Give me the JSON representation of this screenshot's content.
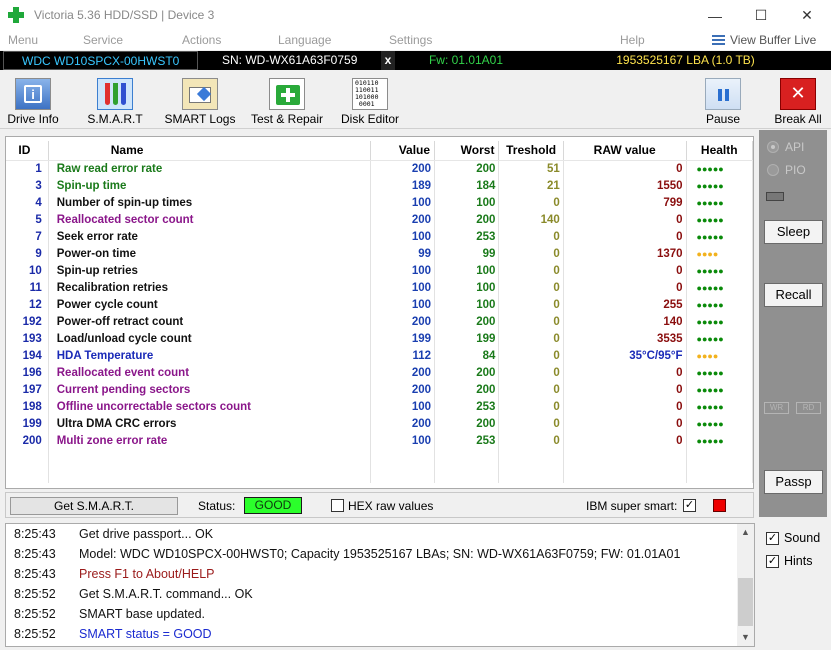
{
  "window": {
    "title": "Victoria 5.36 HDD/SSD | Device 3",
    "minimize": "—",
    "maximize": "☐",
    "close": "✕"
  },
  "menu": {
    "items": [
      "Menu",
      "Service",
      "Actions",
      "Language",
      "Settings",
      "Help"
    ],
    "view_buffer": "View Buffer Live"
  },
  "device": {
    "model": "WDC WD10SPCX-00HWST0",
    "serial": "SN: WD-WX61A63F0759",
    "x": "x",
    "firmware": "Fw: 01.01A01",
    "lba": "1953525167 LBA (1.0 TB)"
  },
  "toolbar": {
    "drive_info": "Drive Info",
    "smart": "S.M.A.R.T",
    "smart_logs": "SMART Logs",
    "test_repair": "Test & Repair",
    "disk_editor": "Disk Editor",
    "pause": "Pause",
    "break_all": "Break All",
    "binary_glyph": "010110\n110011\n101000\n0001"
  },
  "smart": {
    "headers": [
      "ID",
      "Name",
      "Value",
      "Worst",
      "Treshold",
      "RAW value",
      "Health"
    ],
    "rows": [
      {
        "id": "1",
        "name": "Raw read error rate",
        "value": "200",
        "worst": "200",
        "tresh": "51",
        "raw": "0",
        "health": "●●●●●",
        "hcolor": "green",
        "ncolor": "#1a7a1a"
      },
      {
        "id": "3",
        "name": "Spin-up time",
        "value": "189",
        "worst": "184",
        "tresh": "21",
        "raw": "1550",
        "health": "●●●●●",
        "hcolor": "green",
        "ncolor": "#1a7a1a"
      },
      {
        "id": "4",
        "name": "Number of spin-up times",
        "value": "100",
        "worst": "100",
        "tresh": "0",
        "raw": "799",
        "health": "●●●●●",
        "hcolor": "green",
        "ncolor": "#111111"
      },
      {
        "id": "5",
        "name": "Reallocated sector count",
        "value": "200",
        "worst": "200",
        "tresh": "140",
        "raw": "0",
        "health": "●●●●●",
        "hcolor": "green",
        "ncolor": "#8a168a"
      },
      {
        "id": "7",
        "name": "Seek error rate",
        "value": "100",
        "worst": "253",
        "tresh": "0",
        "raw": "0",
        "health": "●●●●●",
        "hcolor": "green",
        "ncolor": "#111111"
      },
      {
        "id": "9",
        "name": "Power-on time",
        "value": "99",
        "worst": "99",
        "tresh": "0",
        "raw": "1370",
        "health": "●●●●",
        "hcolor": "yellow",
        "ncolor": "#111111"
      },
      {
        "id": "10",
        "name": "Spin-up retries",
        "value": "100",
        "worst": "100",
        "tresh": "0",
        "raw": "0",
        "health": "●●●●●",
        "hcolor": "green",
        "ncolor": "#111111"
      },
      {
        "id": "11",
        "name": "Recalibration retries",
        "value": "100",
        "worst": "100",
        "tresh": "0",
        "raw": "0",
        "health": "●●●●●",
        "hcolor": "green",
        "ncolor": "#111111"
      },
      {
        "id": "12",
        "name": "Power cycle count",
        "value": "100",
        "worst": "100",
        "tresh": "0",
        "raw": "255",
        "health": "●●●●●",
        "hcolor": "green",
        "ncolor": "#111111"
      },
      {
        "id": "192",
        "name": "Power-off retract count",
        "value": "200",
        "worst": "200",
        "tresh": "0",
        "raw": "140",
        "health": "●●●●●",
        "hcolor": "green",
        "ncolor": "#111111"
      },
      {
        "id": "193",
        "name": "Load/unload cycle count",
        "value": "199",
        "worst": "199",
        "tresh": "0",
        "raw": "3535",
        "health": "●●●●●",
        "hcolor": "green",
        "ncolor": "#111111"
      },
      {
        "id": "194",
        "name": "HDA Temperature",
        "value": "112",
        "worst": "84",
        "tresh": "0",
        "raw": "35°C/95°F",
        "health": "●●●●",
        "hcolor": "yellow",
        "ncolor": "#1a2ab8",
        "rawcolor": "#1a2ab8"
      },
      {
        "id": "196",
        "name": "Reallocated event count",
        "value": "200",
        "worst": "200",
        "tresh": "0",
        "raw": "0",
        "health": "●●●●●",
        "hcolor": "green",
        "ncolor": "#8a168a"
      },
      {
        "id": "197",
        "name": "Current pending sectors",
        "value": "200",
        "worst": "200",
        "tresh": "0",
        "raw": "0",
        "health": "●●●●●",
        "hcolor": "green",
        "ncolor": "#8a168a"
      },
      {
        "id": "198",
        "name": "Offline uncorrectable sectors count",
        "value": "100",
        "worst": "253",
        "tresh": "0",
        "raw": "0",
        "health": "●●●●●",
        "hcolor": "green",
        "ncolor": "#8a168a"
      },
      {
        "id": "199",
        "name": "Ultra DMA CRC errors",
        "value": "200",
        "worst": "200",
        "tresh": "0",
        "raw": "0",
        "health": "●●●●●",
        "hcolor": "green",
        "ncolor": "#111111"
      },
      {
        "id": "200",
        "name": "Multi zone error rate",
        "value": "100",
        "worst": "253",
        "tresh": "0",
        "raw": "0",
        "health": "●●●●●",
        "hcolor": "green",
        "ncolor": "#8a168a"
      }
    ]
  },
  "status_strip": {
    "get_smart": "Get S.M.A.R.T.",
    "status_label": "Status:",
    "status_value": "GOOD",
    "hex_label": "HEX raw values",
    "hex_checked": "",
    "ibm_label": "IBM super smart:",
    "ibm_checked": "✓"
  },
  "right_panel": {
    "api": "API",
    "pio": "PIO",
    "sleep": "Sleep",
    "recall": "Recall",
    "wr": "WR",
    "rd": "RD",
    "passp": "Passp"
  },
  "log": [
    {
      "time": "8:25:43",
      "msg": "Get drive passport... OK",
      "color": "#111111"
    },
    {
      "time": "8:25:43",
      "msg": "Model: WDC WD10SPCX-00HWST0; Capacity 1953525167 LBAs; SN: WD-WX61A63F0759; FW: 01.01A01",
      "color": "#111111"
    },
    {
      "time": "8:25:43",
      "msg": "Press F1 to About/HELP",
      "color": "#9a1a1a"
    },
    {
      "time": "8:25:52",
      "msg": "Get S.M.A.R.T. command... OK",
      "color": "#111111"
    },
    {
      "time": "8:25:52",
      "msg": "SMART base updated.",
      "color": "#111111"
    },
    {
      "time": "8:25:52",
      "msg": "SMART status = GOOD",
      "color": "#1a2ad0"
    }
  ],
  "options": {
    "sound": "Sound",
    "sound_checked": "✓",
    "hints": "Hints",
    "hints_checked": "✓"
  }
}
